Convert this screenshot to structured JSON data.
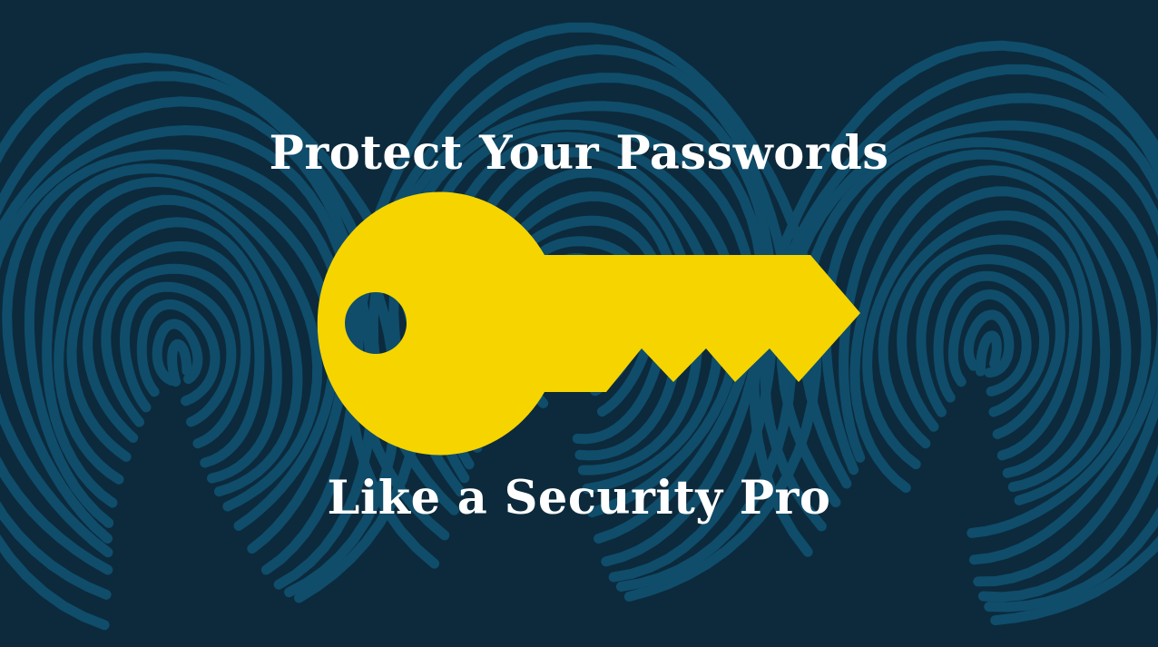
{
  "headline": {
    "line1": "Protect Your Passwords",
    "line2": "Like a Security Pro"
  },
  "colors": {
    "background": "#0c2a3c",
    "fingerprint": "#0f4d6b",
    "key": "#f5d400",
    "text": "#ffffff"
  },
  "graphics": {
    "background_icon": "fingerprint-icon",
    "foreground_icon": "key-icon"
  }
}
